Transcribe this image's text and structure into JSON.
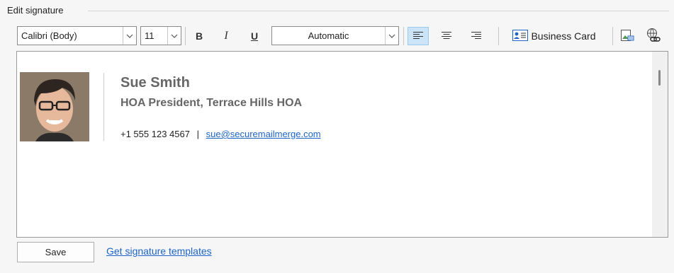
{
  "group": {
    "title": "Edit signature"
  },
  "toolbar": {
    "font_name": "Calibri (Body)",
    "font_size": "11",
    "bold_label": "B",
    "italic_label": "I",
    "underline_label": "U",
    "color_value": "Automatic",
    "business_card_label": "Business Card",
    "icons": [
      "chevron-down-icon",
      "align-left-icon",
      "align-center-icon",
      "align-right-icon",
      "business-card-icon",
      "insert-picture-icon",
      "hyperlink-icon"
    ]
  },
  "signature": {
    "name": "Sue Smith",
    "title": "HOA President, Terrace Hills HOA",
    "phone": "+1 555 123 4567",
    "separator": "|",
    "email": "sue@securemailmerge.com"
  },
  "footer": {
    "save_label": "Save",
    "templates_link": "Get signature templates"
  },
  "colors": {
    "link": "#1c64c8",
    "name_text": "#666666",
    "active_button": "#cce4f7"
  }
}
